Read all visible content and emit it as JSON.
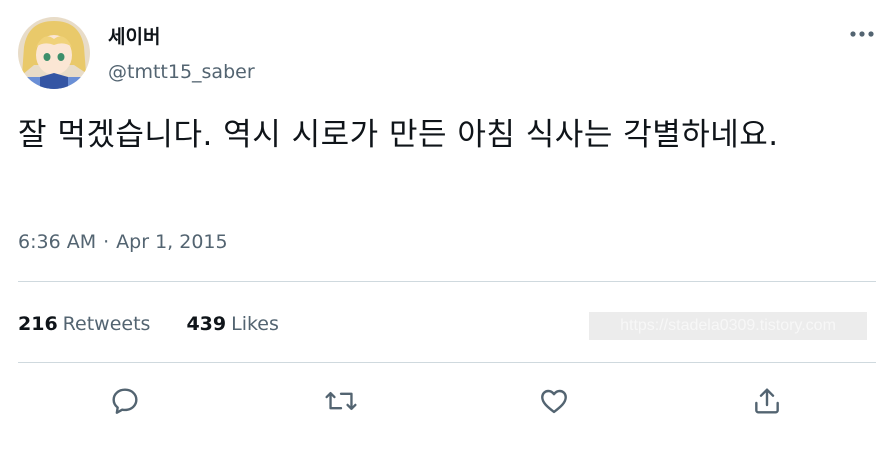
{
  "author": {
    "display_name": "세이버",
    "handle": "@tmtt15_saber",
    "avatar_icon": "profile-avatar-icon"
  },
  "tweet": {
    "text": "잘 먹겠습니다. 역시 시로가 만든 아침 식사는 각별하네요.",
    "time": "6:36 AM",
    "separator": "·",
    "date": "Apr 1, 2015"
  },
  "stats": {
    "retweets_count": "216",
    "retweets_label": "Retweets",
    "likes_count": "439",
    "likes_label": "Likes"
  },
  "watermark": "https://stadela0309.tistory.com",
  "actions": {
    "reply_icon": "reply-icon",
    "retweet_icon": "retweet-icon",
    "like_icon": "heart-icon",
    "share_icon": "share-icon",
    "more_icon": "more-icon"
  },
  "colors": {
    "text_primary": "#0f1419",
    "text_secondary": "#536471",
    "divider": "#cfd9de"
  }
}
